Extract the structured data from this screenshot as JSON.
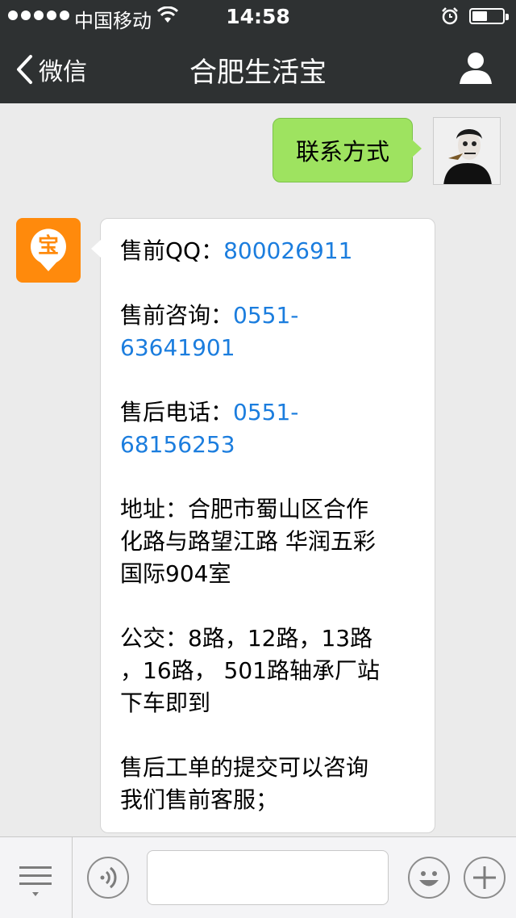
{
  "status_bar": {
    "carrier": "中国移动",
    "time": "14:58"
  },
  "nav": {
    "back_label": "微信",
    "title": "合肥生活宝"
  },
  "messages": {
    "outgoing": "联系方式",
    "incoming": {
      "presale_qq_label": "售前QQ：",
      "presale_qq": "800026911",
      "presale_consult_label": "售前咨询：",
      "presale_consult_phone_a": "0551-",
      "presale_consult_phone_b": "63641901",
      "aftersale_label": "售后电话：",
      "aftersale_phone_a": "0551-",
      "aftersale_phone_b": "68156253",
      "address_line1": "地址：合肥市蜀山区合作",
      "address_line2": "化路与路望江路 华润五彩",
      "address_line3": "国际904室",
      "bus_line1": "公交：8路，12路，13路",
      "bus_line2": "，16路， 501路轴承厂站",
      "bus_line3": "下车即到",
      "ticket_line1": "售后工单的提交可以咨询",
      "ticket_line2": "我们售前客服；"
    }
  },
  "avatars": {
    "official_account_glyph": "宝"
  },
  "colors": {
    "bar_bg": "#2e3132",
    "chat_bg": "#ebebeb",
    "out_bubble": "#9ee360",
    "link": "#1b7dde",
    "brand_orange": "#ff8a0c"
  }
}
